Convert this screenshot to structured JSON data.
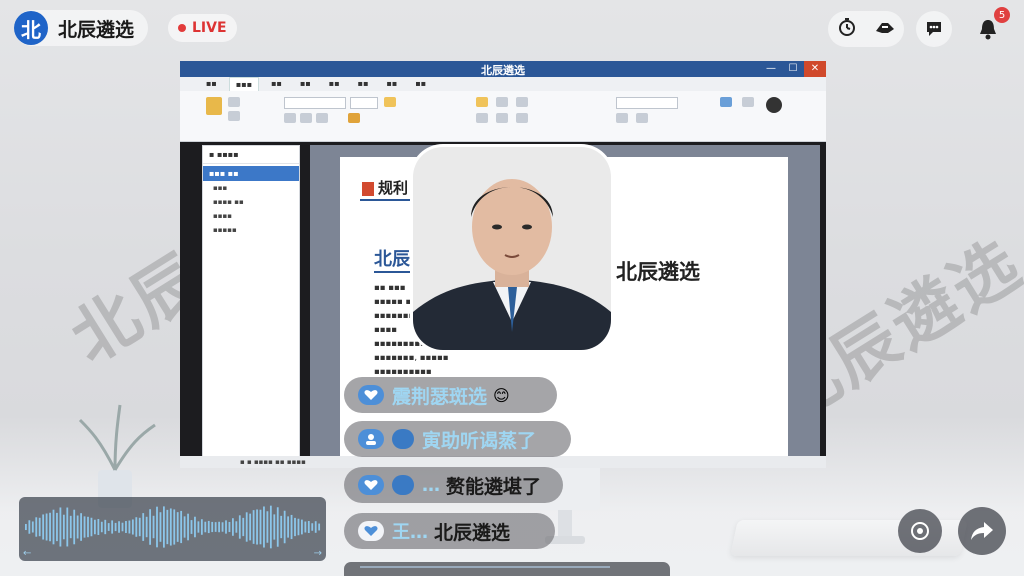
{
  "header": {
    "logo_char": "北",
    "brand_name": "北辰遴选",
    "live_label": "LIVE",
    "notification_count": "5"
  },
  "watermark": {
    "text": "北辰遴选"
  },
  "shared_screen": {
    "window_title": "北辰遴选",
    "doc_heading": "规利",
    "doc_subheading": "北辰",
    "presenter_label": "北辰遴选"
  },
  "chat": {
    "messages": [
      {
        "author": "",
        "text": "震荆瑟斑选",
        "emoji": "😊",
        "style": "highlight"
      },
      {
        "author": "",
        "text": "寅助听谒蒸了",
        "emoji": "",
        "style": "highlight"
      },
      {
        "author": "…",
        "text": "赘能遴堪了",
        "emoji": "",
        "style": "plain"
      },
      {
        "author": "王…",
        "text": "北辰遴选",
        "emoji": "",
        "style": "plain"
      }
    ]
  },
  "colors": {
    "brand_blue": "#1f64c8",
    "live_red": "#e23b3b",
    "chat_accent": "#9fd6f2",
    "word_ribbon": "#2b5797"
  },
  "icons": [
    "timer-icon",
    "handshake-icon",
    "chat-icon",
    "bell-icon",
    "camera-target-icon",
    "share-icon",
    "heart-icon"
  ]
}
